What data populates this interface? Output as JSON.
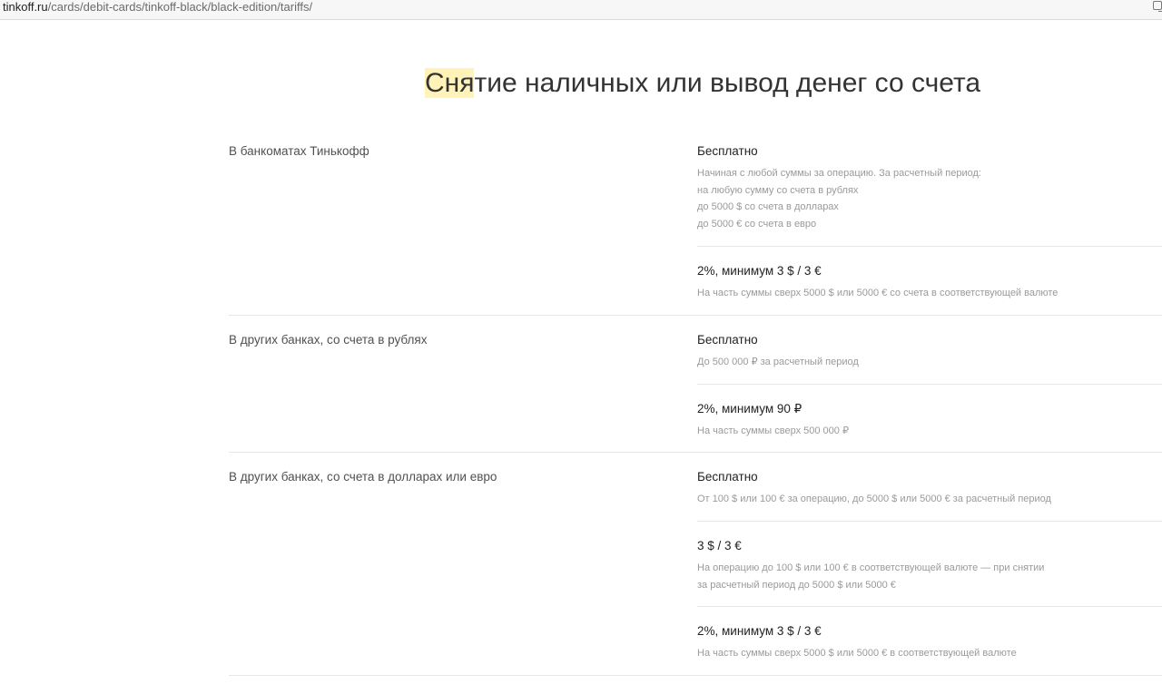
{
  "browser": {
    "url_host": "tinkoff.ru",
    "url_path": "/cards/debit-cards/tinkoff-black/black-edition/tariffs/"
  },
  "page": {
    "title_highlight": "Сня",
    "title_rest": "тие наличных или вывод денег со счета"
  },
  "sections": [
    {
      "label": "В банкоматах Тинькофф",
      "tariffs": [
        {
          "title": "Бесплатно",
          "lines": [
            "Начиная с любой суммы за операцию. За расчетный период:",
            "на любую сумму со счета в рублях",
            "до 5000 $ со счета в долларах",
            "до 5000 € со счета в евро"
          ]
        },
        {
          "title": "2%, минимум 3 $ / 3 €",
          "lines": [
            "На часть суммы сверх 5000 $ или 5000 € со счета в соответствующей валюте"
          ]
        }
      ]
    },
    {
      "label": "В других банках, со счета в рублях",
      "tariffs": [
        {
          "title": "Бесплатно",
          "lines": [
            "До 500 000 ₽ за расчетный период"
          ]
        },
        {
          "title": "2%, минимум 90 ₽",
          "lines": [
            "На часть суммы сверх 500 000 ₽"
          ]
        }
      ]
    },
    {
      "label": "В других банках, со счета в долларах или евро",
      "tariffs": [
        {
          "title": "Бесплатно",
          "lines": [
            "От 100 $ или 100 € за операцию, до 5000 $ или 5000 € за расчетный период"
          ]
        },
        {
          "title": "3 $ / 3 €",
          "lines": [
            "На операцию до 100 $ или 100 € в соответствующей валюте — при снятии",
            "за расчетный период до 5000 $ или 5000 €"
          ]
        },
        {
          "title": "2%, минимум 3 $ / 3 €",
          "lines": [
            "На часть суммы сверх 5000 $ или 5000 € в соответствующей валюте"
          ]
        }
      ]
    }
  ]
}
